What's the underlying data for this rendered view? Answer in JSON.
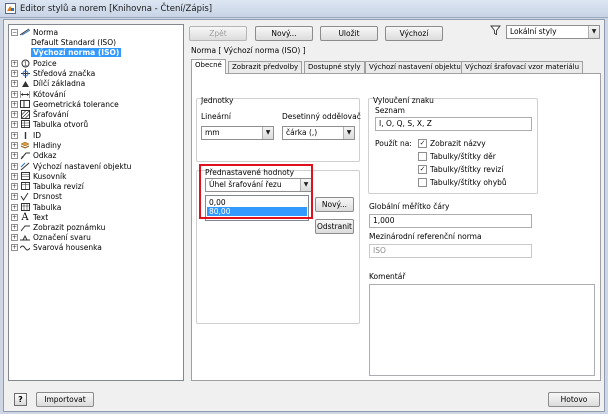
{
  "window": {
    "title": "Editor stylů a norem [Knihovna - Čtení/Zápis]"
  },
  "toolbar": {
    "back_label": "Zpět",
    "new_label": "Nový...",
    "save_label": "Uložit",
    "default_label": "Výchozí",
    "filter_value": "Lokální styly"
  },
  "tree": {
    "items": [
      {
        "label": "Norma"
      },
      {
        "label": "Default Standard (ISO)"
      },
      {
        "label": "Výchozí norma (ISO)"
      },
      {
        "label": "Pozice"
      },
      {
        "label": "Středová značka"
      },
      {
        "label": "Dílčí základna"
      },
      {
        "label": "Kótování"
      },
      {
        "label": "Geometrická tolerance"
      },
      {
        "label": "Šrafování"
      },
      {
        "label": "Tabulka otvorů"
      },
      {
        "label": "ID"
      },
      {
        "label": "Hladiny"
      },
      {
        "label": "Odkaz"
      },
      {
        "label": "Výchozí nastavení objektu"
      },
      {
        "label": "Kusovník"
      },
      {
        "label": "Tabulka revizí"
      },
      {
        "label": "Drsnost"
      },
      {
        "label": "Tabulka"
      },
      {
        "label": "Text"
      },
      {
        "label": "Zobrazit poznámku"
      },
      {
        "label": "Označení svaru"
      },
      {
        "label": "Svarová housenka"
      }
    ]
  },
  "main": {
    "heading": "Norma [ Výchozí norma (ISO) ]",
    "tabs": [
      {
        "label": "Obecné"
      },
      {
        "label": "Zobrazit předvolby"
      },
      {
        "label": "Dostupné styly"
      },
      {
        "label": "Výchozí nastavení objektu"
      },
      {
        "label": "Výchozí šrafovací vzor materiálu"
      }
    ],
    "units": {
      "title": "Jednotky",
      "linear_label": "Lineární",
      "linear_value": "mm",
      "decimal_label": "Desetinný oddělovač",
      "decimal_value": "čárka (,)"
    },
    "presets": {
      "title": "Přednastavené hodnoty",
      "combo_value": "Úhel šrafování řezu",
      "list": [
        "0,00",
        "80,00"
      ],
      "new_label": "Nový...",
      "remove_label": "Odstranit"
    },
    "exclude": {
      "title": "Vyloučení znaku",
      "list_label": "Seznam",
      "list_value": "I, O, Q, S, X, Z",
      "use_label": "Použít na:",
      "options": [
        {
          "label": "Zobrazit názvy",
          "checked": true
        },
        {
          "label": "Tabulky/štítky děr",
          "checked": false
        },
        {
          "label": "Tabulky/štítky revizí",
          "checked": true
        },
        {
          "label": "Tabulky/štítky ohybů",
          "checked": false
        }
      ]
    },
    "scale": {
      "label": "Globální měřítko čáry",
      "value": "1,000"
    },
    "intl_norm": {
      "label": "Mezinárodní referenční norma",
      "value": "ISO"
    },
    "comment": {
      "label": "Komentář"
    }
  },
  "footer": {
    "help_label": "?",
    "import_label": "Importovat",
    "done_label": "Hotovo"
  }
}
